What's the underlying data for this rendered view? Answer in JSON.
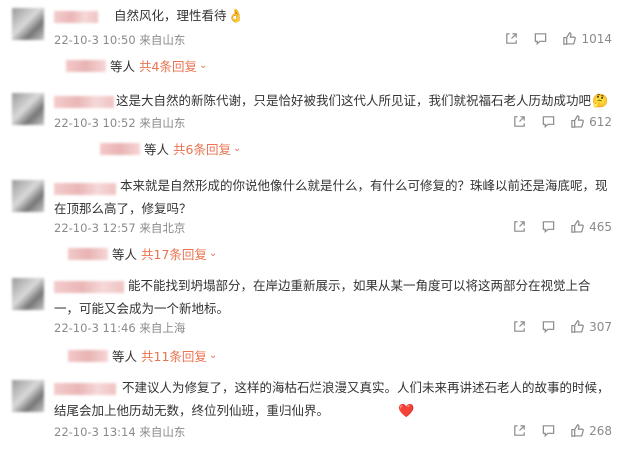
{
  "comments": [
    {
      "text": "自然风化，理性看待",
      "emoji": "👌",
      "meta": "22-10-3 10:50 来自山东",
      "likes": "1014",
      "replies": {
        "prefix": "等人",
        "link": "共4条回复"
      }
    },
    {
      "text": "这是大自然的新陈代谢，只是恰好被我们这代人所见证，我们就祝福石老人历劫成功吧",
      "emoji": "🤔",
      "meta": "22-10-3 10:52 来自山东",
      "likes": "612",
      "replies": {
        "prefix": "等人",
        "link": "共6条回复"
      }
    },
    {
      "text": "本来就是自然形成的你说他像什么就是什么，有什么可修复的？珠峰以前还是海底呢，现在顶那么高了，修复吗？",
      "emoji": "",
      "meta": "22-10-3 12:57 来自北京",
      "likes": "465",
      "replies": {
        "prefix": "等人",
        "link": "共17条回复"
      }
    },
    {
      "text": "能不能找到坍塌部分，在岸边重新展示，如果从某一角度可以将这两部分在视觉上合一，可能又会成为一个新地标。",
      "emoji": "",
      "meta": "22-10-3 11:46 来自上海",
      "likes": "307",
      "replies": {
        "prefix": "等人",
        "link": "共11条回复"
      }
    },
    {
      "text": "不建议人为修复了，这样的海枯石烂浪漫又真实。人们未来再讲述石老人的故事的时候，结尾会加上他历劫无数，终位列仙班，重归仙界。",
      "emoji": "❤️",
      "meta": "22-10-3 13:14 来自山东",
      "likes": "268",
      "replies": null
    }
  ]
}
